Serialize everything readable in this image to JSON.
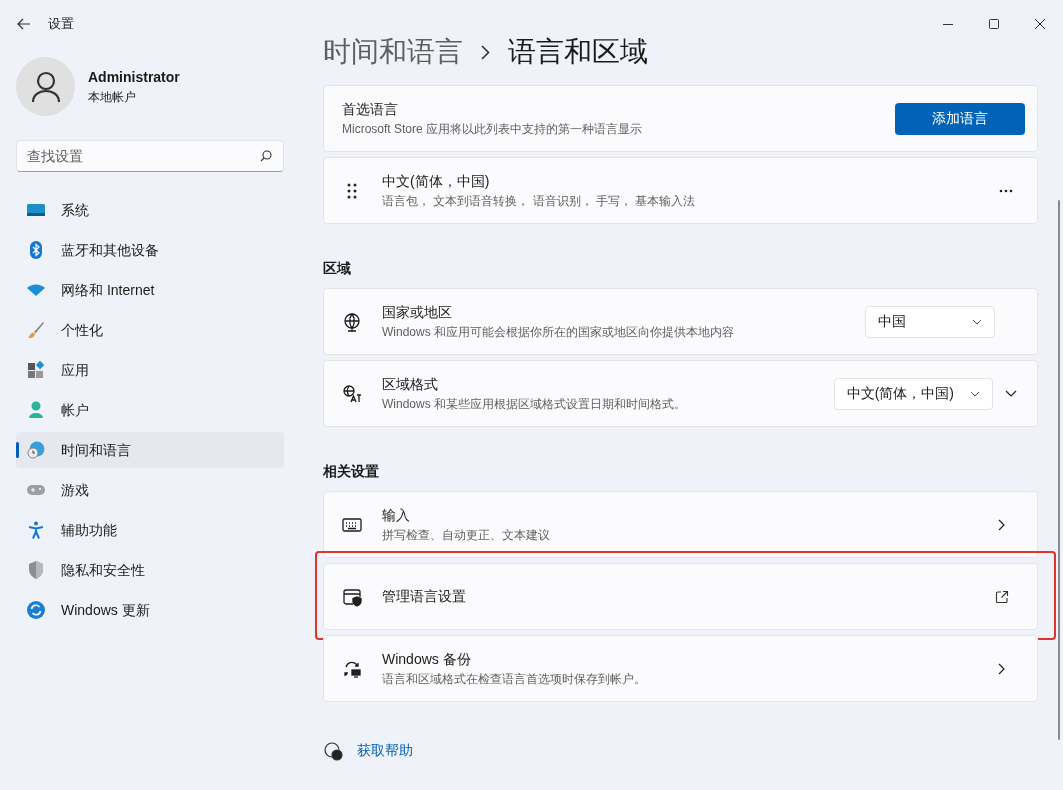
{
  "window": {
    "title": "设置"
  },
  "account": {
    "name": "Administrator",
    "type": "本地帐户"
  },
  "search": {
    "placeholder": "查找设置"
  },
  "nav": [
    {
      "label": "系统",
      "selected": false
    },
    {
      "label": "蓝牙和其他设备",
      "selected": false
    },
    {
      "label": "网络和 Internet",
      "selected": false
    },
    {
      "label": "个性化",
      "selected": false
    },
    {
      "label": "应用",
      "selected": false
    },
    {
      "label": "帐户",
      "selected": false
    },
    {
      "label": "时间和语言",
      "selected": true
    },
    {
      "label": "游戏",
      "selected": false
    },
    {
      "label": "辅助功能",
      "selected": false
    },
    {
      "label": "隐私和安全性",
      "selected": false
    },
    {
      "label": "Windows 更新",
      "selected": false
    }
  ],
  "breadcrumb": {
    "parent": "时间和语言",
    "current": "语言和区域"
  },
  "sections": [
    {
      "rows": [
        {
          "kind": "button",
          "title": "首选语言",
          "subtitle": "Microsoft Store 应用将以此列表中支持的第一种语言显示",
          "button": "添加语言",
          "highlighted": false
        },
        {
          "kind": "more",
          "title": "中文(简体，中国)",
          "subtitle": "语言包， 文本到语音转换， 语音识别， 手写， 基本输入法",
          "highlighted": false
        }
      ]
    },
    {
      "heading": "区域",
      "rows": [
        {
          "kind": "dropdown",
          "title": "国家或地区",
          "subtitle": "Windows 和应用可能会根据你所在的国家或地区向你提供本地内容",
          "value": "中国",
          "highlighted": false
        },
        {
          "kind": "dropdown-expand",
          "title": "区域格式",
          "subtitle": "Windows 和某些应用根据区域格式设置日期和时间格式。",
          "value": "中文(简体，中国)",
          "highlighted": false
        }
      ]
    },
    {
      "heading": "相关设置",
      "rows": [
        {
          "kind": "chevron",
          "title": "输入",
          "subtitle": "拼写检查、自动更正、文本建议",
          "highlighted": false
        },
        {
          "kind": "external",
          "title": "管理语言设置",
          "highlighted": true
        },
        {
          "kind": "chevron",
          "title": "Windows 备份",
          "subtitle": "语言和区域格式在检查语言首选项时保存到帐户。",
          "highlighted": false
        }
      ]
    }
  ],
  "help": {
    "label": "获取帮助"
  }
}
